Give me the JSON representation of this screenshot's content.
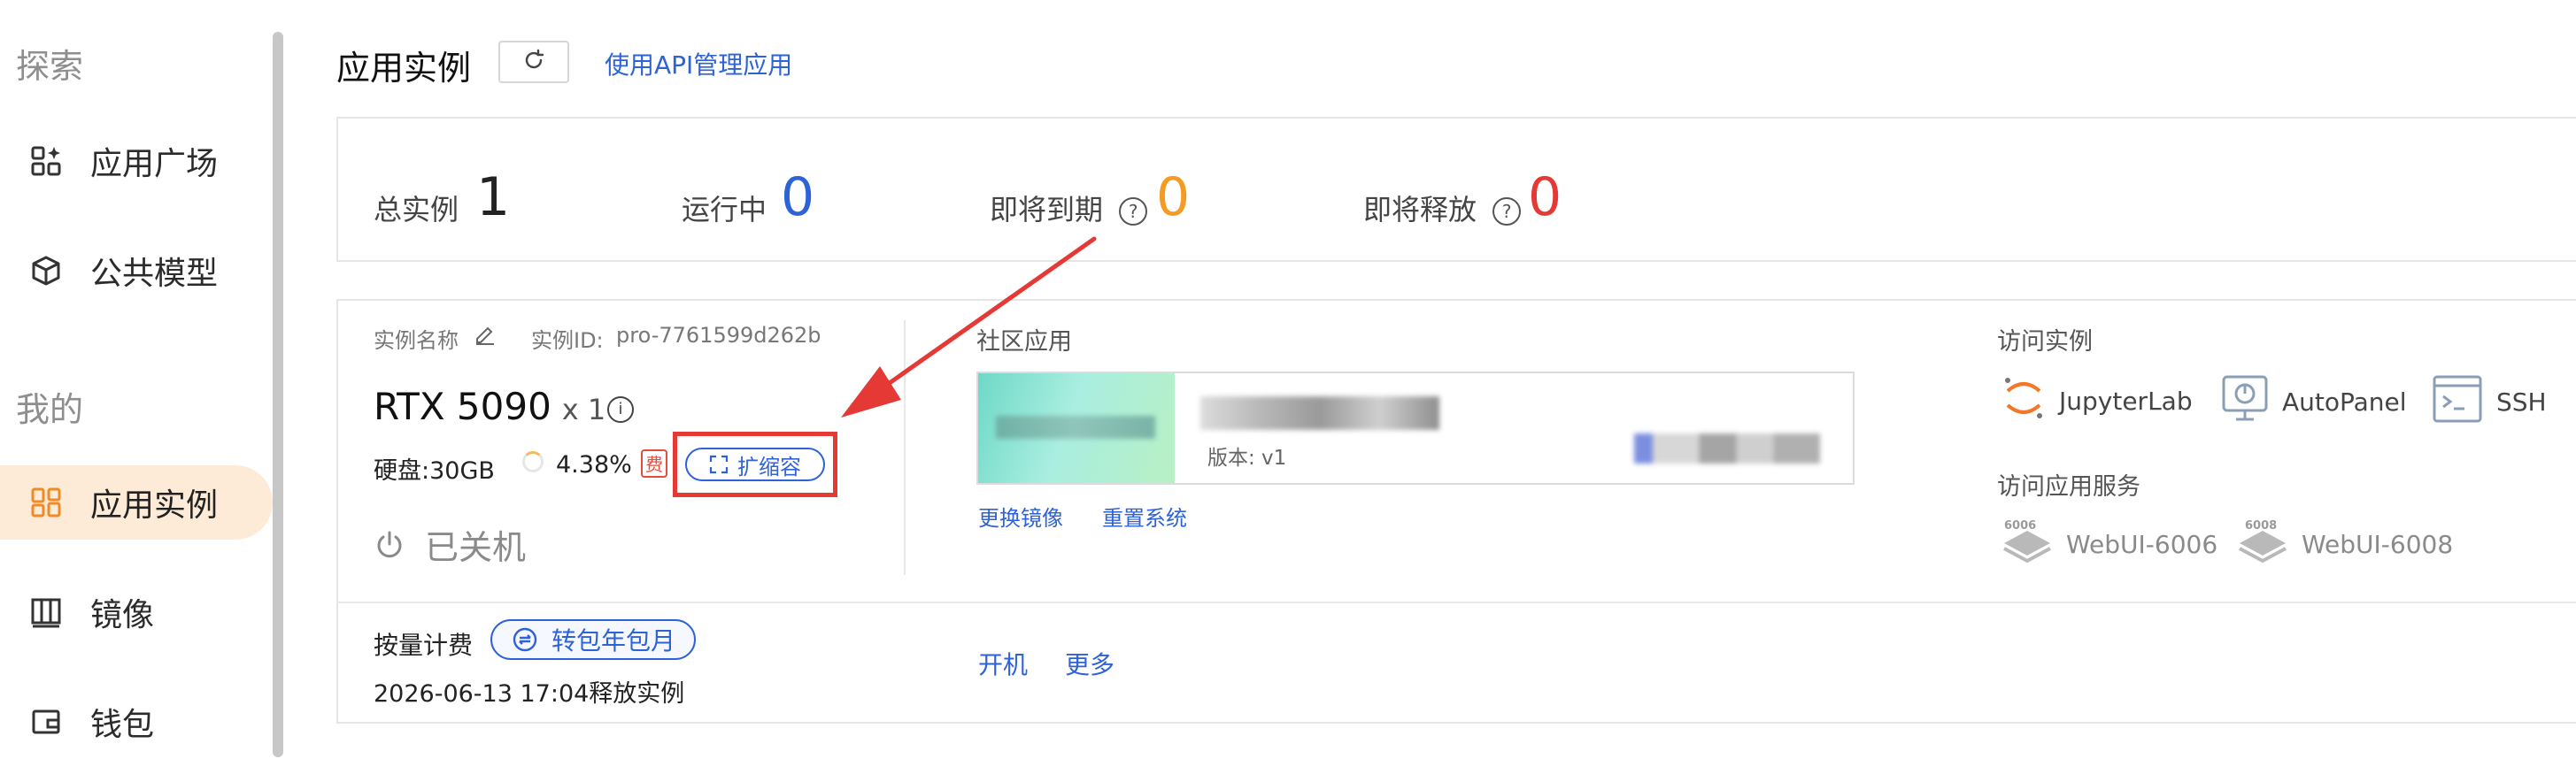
{
  "sidebar": {
    "explore_label": "探索",
    "mine_label": "我的",
    "explore_items": [
      {
        "label": "应用广场",
        "icon": "app-grid-icon"
      },
      {
        "label": "公共模型",
        "icon": "cube-icon"
      }
    ],
    "mine_items": [
      {
        "label": "应用实例",
        "icon": "instances-grid-icon",
        "active": true
      },
      {
        "label": "镜像",
        "icon": "image-columns-icon"
      },
      {
        "label": "钱包",
        "icon": "wallet-icon"
      }
    ]
  },
  "header": {
    "title": "应用实例",
    "refresh_icon": "refresh-icon",
    "api_link": "使用API管理应用"
  },
  "stats": {
    "total_label": "总实例",
    "total_value": "1",
    "running_label": "运行中",
    "running_value": "0",
    "expiring_label": "即将到期",
    "expiring_value": "0",
    "releasing_label": "即将释放",
    "releasing_value": "0",
    "help_glyph": "?"
  },
  "instance": {
    "name_label": "实例名称",
    "id_label": "实例ID:",
    "id_value": "pro-7761599d262b",
    "gpu": "RTX 5090",
    "gpu_count": "x 1",
    "info_glyph": "i",
    "disk_label": "硬盘:",
    "disk_value": "30GB",
    "disk_usage": "4.38%",
    "fee_badge": "费",
    "expand_button": "扩缩容",
    "status": "已关机",
    "community_label": "社区应用",
    "app_version": "版本: v1",
    "change_image": "更换镜像",
    "reset_system": "重置系统",
    "access_label": "访问实例",
    "access_items": [
      {
        "label": "JupyterLab",
        "icon": "jupyter-icon"
      },
      {
        "label": "AutoPanel",
        "icon": "autopanel-icon"
      },
      {
        "label": "SSH",
        "icon": "terminal-icon"
      }
    ],
    "service_label": "访问应用服务",
    "service_items": [
      {
        "label": "WebUI-6006",
        "icon": "webui-6006-icon",
        "badge": "6006"
      },
      {
        "label": "WebUI-6008",
        "icon": "webui-6008-icon",
        "badge": "6008"
      }
    ],
    "billing_label": "按量计费",
    "package_button": "转包年包月",
    "release_text": "2026-06-13 17:04释放实例",
    "power_on": "开机",
    "more": "更多"
  },
  "colors": {
    "accent_blue": "#2e62d8",
    "orange": "#f59a23",
    "red": "#e53935",
    "active_bg": "#fdebd7"
  }
}
